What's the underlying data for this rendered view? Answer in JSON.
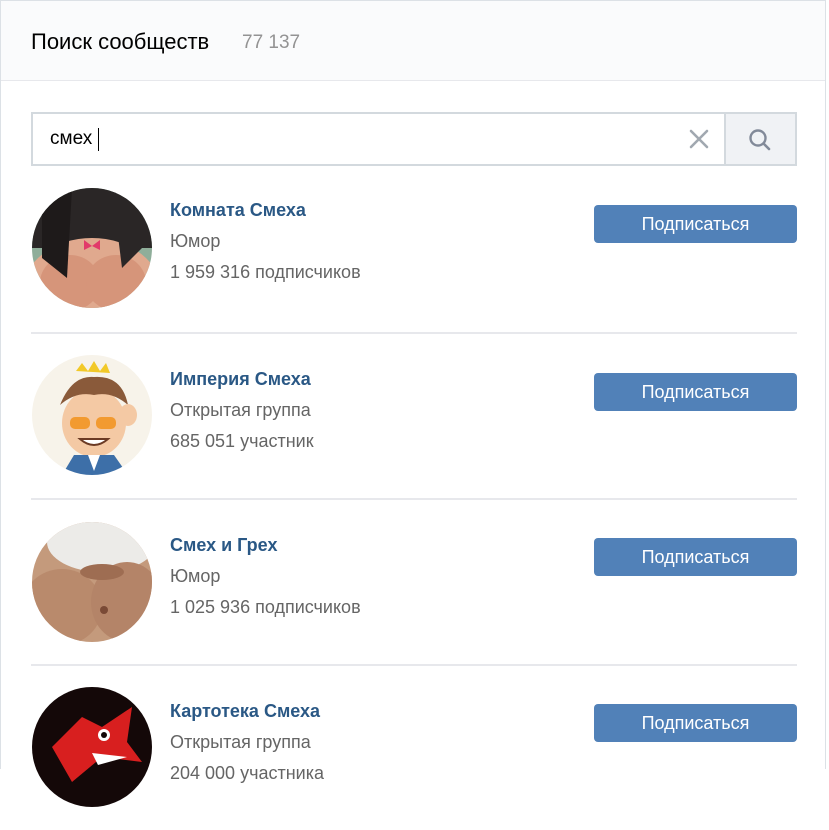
{
  "header": {
    "title": "Поиск сообществ",
    "count": "77 137"
  },
  "search": {
    "value": "смех",
    "clear_icon": "close-icon",
    "search_icon": "search-icon"
  },
  "communities": [
    {
      "name": "Комната Смеха",
      "type": "Юмор",
      "subscribers": "1 959 316 подписчиков",
      "button": "Подписаться"
    },
    {
      "name": "Империя Смеха",
      "type": "Открытая группа",
      "subscribers": "685 051 участник",
      "button": "Подписаться"
    },
    {
      "name": "Смех и Грех",
      "type": "Юмор",
      "subscribers": "1 025 936 подписчиков",
      "button": "Подписаться"
    },
    {
      "name": "Картотека Смеха",
      "type": "Открытая группа",
      "subscribers": "204 000 участника",
      "button": "Подписаться"
    }
  ],
  "colors": {
    "link": "#2a5885",
    "button": "#5181b8",
    "muted": "#939393"
  }
}
